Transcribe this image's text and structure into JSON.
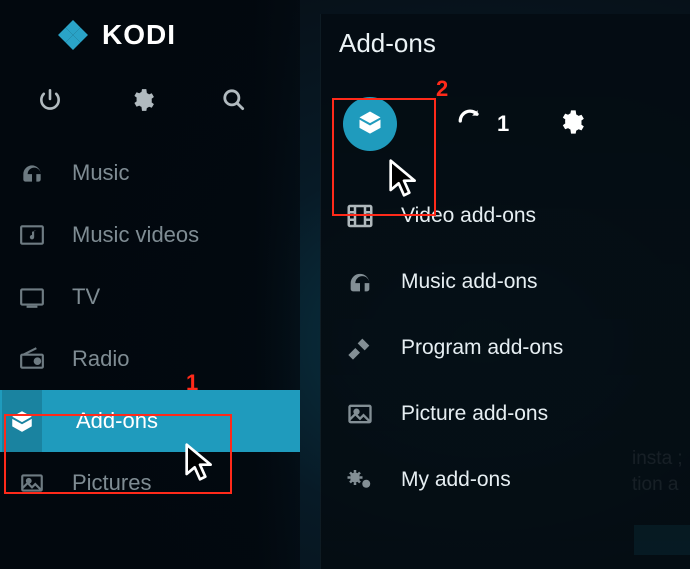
{
  "app": {
    "name": "KODI"
  },
  "sidebar": {
    "items": [
      {
        "label": "Music"
      },
      {
        "label": "Music videos"
      },
      {
        "label": "TV"
      },
      {
        "label": "Radio"
      },
      {
        "label": "Add-ons"
      },
      {
        "label": "Pictures"
      }
    ]
  },
  "panel": {
    "title": "Add-ons",
    "update_count": "1",
    "categories": [
      {
        "label": "Video add-ons"
      },
      {
        "label": "Music add-ons"
      },
      {
        "label": "Program add-ons"
      },
      {
        "label": "Picture add-ons"
      },
      {
        "label": "My add-ons"
      }
    ]
  },
  "annotations": {
    "label1": "1",
    "label2": "2"
  },
  "bg": {
    "line1": "; insta",
    "line2": "tion a"
  }
}
